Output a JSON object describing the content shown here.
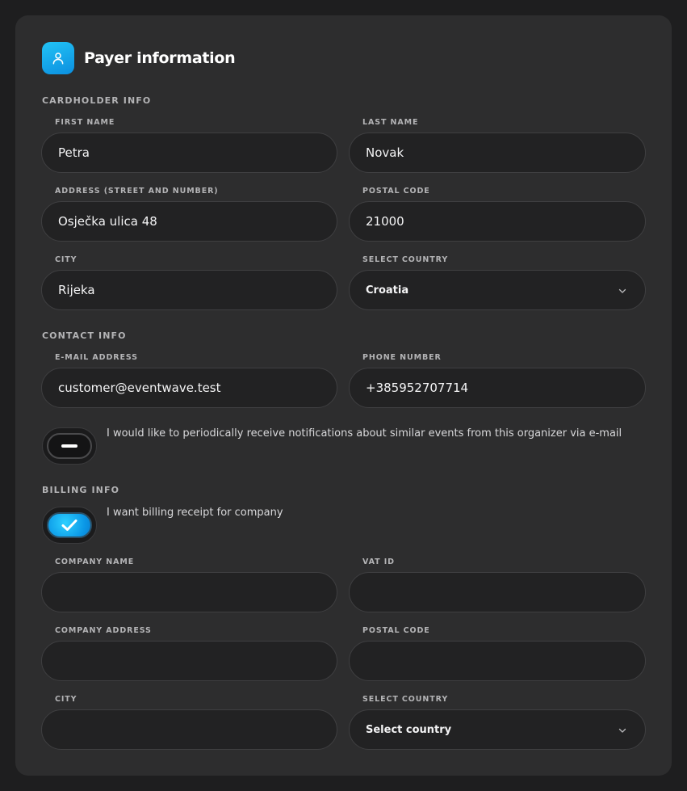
{
  "header": {
    "title": "Payer information",
    "icon": "user-icon"
  },
  "sections": {
    "cardholder": "CARDHOLDER INFO",
    "contact": "CONTACT INFO",
    "billing": "BILLING INFO"
  },
  "cardholder": {
    "first_name": {
      "label": "FIRST NAME",
      "value": "Petra"
    },
    "last_name": {
      "label": "LAST NAME",
      "value": "Novak"
    },
    "address": {
      "label": "ADDRESS (STREET AND NUMBER)",
      "value": "Osječka ulica 48"
    },
    "postal_code": {
      "label": "POSTAL CODE",
      "value": "21000"
    },
    "city": {
      "label": "CITY",
      "value": "Rijeka"
    },
    "country": {
      "label": "SELECT COUNTRY",
      "value": "Croatia"
    }
  },
  "contact": {
    "email": {
      "label": "E-MAIL ADDRESS",
      "value": "customer@eventwave.test"
    },
    "phone": {
      "label": "PHONE NUMBER",
      "value": "+385952707714"
    },
    "notifications": {
      "label": "I would like to periodically receive notifications about similar events from this organizer via e-mail",
      "checked": false
    }
  },
  "billing": {
    "company_receipt": {
      "label": "I want billing receipt for company",
      "checked": true
    },
    "company_name": {
      "label": "COMPANY NAME",
      "value": ""
    },
    "vat_id": {
      "label": "VAT ID",
      "value": ""
    },
    "company_address": {
      "label": "COMPANY ADDRESS",
      "value": ""
    },
    "postal_code": {
      "label": "POSTAL CODE",
      "value": ""
    },
    "city": {
      "label": "CITY",
      "value": ""
    },
    "country": {
      "label": "SELECT COUNTRY",
      "value": "Select country"
    }
  },
  "colors": {
    "accent": "#1ea8ef",
    "card": "#2d2d2e",
    "background": "#1e1e1f",
    "input": "#222223"
  }
}
